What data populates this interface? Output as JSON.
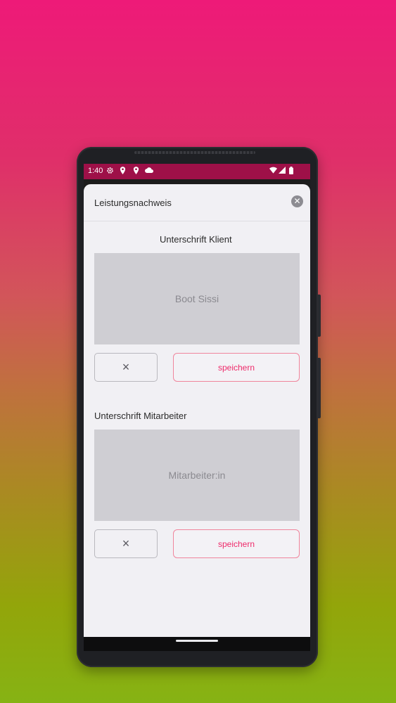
{
  "status_bar": {
    "time": "1:40",
    "left_icons": [
      "gear-icon",
      "location-icon",
      "location-icon",
      "cloud-icon"
    ],
    "right_icons": [
      "wifi-icon",
      "signal-icon",
      "battery-icon"
    ]
  },
  "dialog": {
    "title": "Leistungsnachweis",
    "close_icon": "close-icon"
  },
  "client_signature": {
    "label": "Unterschrift Klient",
    "placeholder": "Boot Sissi",
    "clear_icon": "×",
    "save_label": "speichern"
  },
  "employee_signature": {
    "label": "Unterschrift Mitarbeiter",
    "placeholder": "Mitarbeiter:in",
    "clear_icon": "×",
    "save_label": "speichern"
  },
  "colors": {
    "accent": "#ee2a6a",
    "status_bar": "#9e1048",
    "dialog_bg": "#f1f0f4",
    "signature_bg": "#cfced3"
  }
}
